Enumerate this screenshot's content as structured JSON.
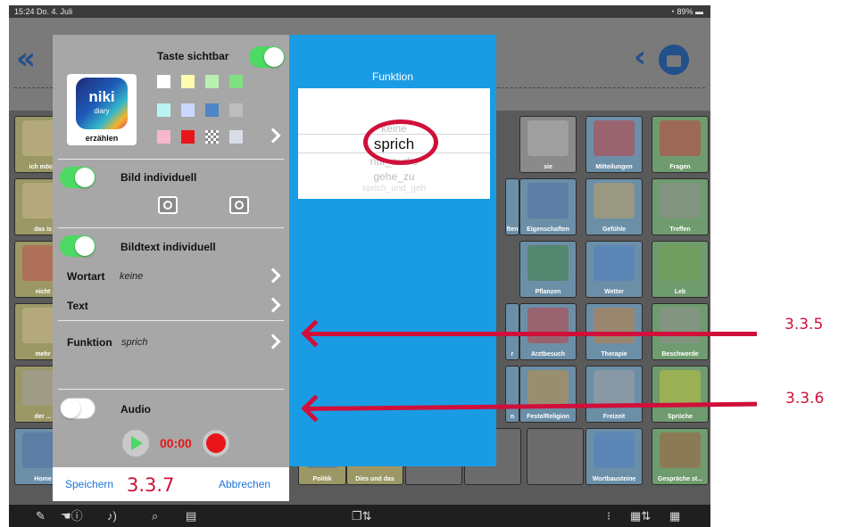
{
  "status": {
    "time": "15:24",
    "date": "Do. 4. Juli",
    "battery": "89%"
  },
  "grid": {
    "labels": [
      "ich möch",
      "das is",
      "nicht",
      "mehr",
      "der ...",
      "Home",
      "sie",
      "Mitteilungen",
      "Fragen",
      "Eigenschaften",
      "Gefühle",
      "Treffen",
      "Pflanzen",
      "Wetter",
      "Leb",
      "Arztbesuch",
      "Therapie",
      "Beschwerde",
      "Feste/Religion",
      "Freizeit",
      "Sprüche",
      "Politik",
      "Dies und das",
      "Wortbausteine",
      "Gespräche st...",
      "ften",
      "n",
      "r"
    ]
  },
  "panel": {
    "visible_label": "Taste sichtbar",
    "logo_line1": "niki",
    "logo_line2": "diary",
    "logo_caption": "erzählen",
    "bild_label": "Bild individuell",
    "bildtext_label": "Bildtext individuell",
    "wortart_label": "Wortart",
    "wortart_value": "keine",
    "text_label": "Text",
    "funktion_label": "Funktion",
    "funktion_value": "sprich",
    "audio_label": "Audio",
    "audio_time": "00:00",
    "save": "Speichern",
    "cancel": "Abbrechen"
  },
  "swatch_colors": [
    "#ffffff",
    "#fffbb0",
    "#b8f0b0",
    "#80e080",
    "#b8f4f4",
    "#c8d8ff",
    "#4f86c6",
    "#bdbdbd",
    "#f6b6cc",
    "#e8161a",
    "#d0d0d0",
    "#d8dde6"
  ],
  "function_picker": {
    "title": "Funktion",
    "options": [
      "keine",
      "sprich",
      "nur_audio",
      "gehe_zu",
      "sprich_und_geh"
    ],
    "selected": "sprich"
  },
  "annotations": {
    "a1": "3.3.5",
    "a2": "3.3.6",
    "a3": "3.3.7"
  },
  "accent": "#d0103a"
}
